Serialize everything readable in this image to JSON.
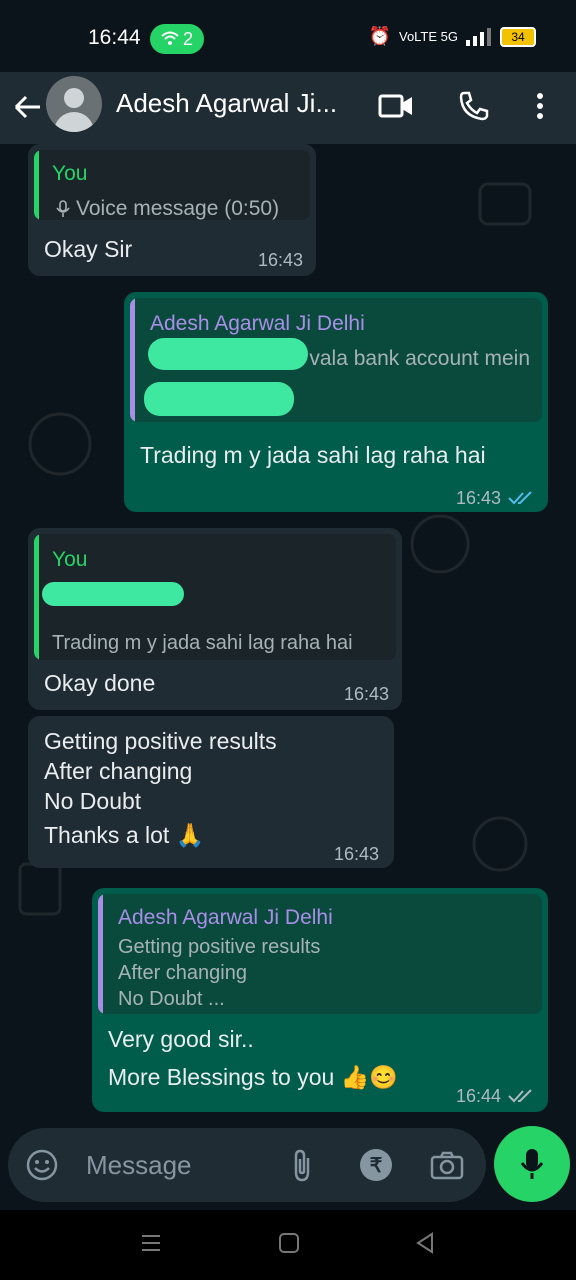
{
  "status": {
    "time": "16:44",
    "hotspot_count": "2",
    "network": "VoLTE 5G",
    "battery": "34"
  },
  "header": {
    "contact_name": "Adesh Agarwal Ji..."
  },
  "messages": {
    "m1": {
      "quote_name": "You",
      "quote_text": "Voice message (0:50)",
      "text": "Okay Sir",
      "time": "16:43"
    },
    "m2": {
      "quote_name": "Adesh Agarwal Ji Delhi",
      "quote_text": "vala bank account mein",
      "text": "Trading m y jada sahi lag raha hai",
      "time": "16:43"
    },
    "m3": {
      "quote_name": "You",
      "quote_text": "Trading m y jada sahi lag raha hai",
      "text": "Okay done",
      "time": "16:43"
    },
    "m4": {
      "line1": "Getting positive results",
      "line2": "After changing",
      "line3": "No Doubt",
      "line4": "Thanks a lot 🙏",
      "time": "16:43"
    },
    "m5": {
      "quote_name": "Adesh Agarwal Ji Delhi",
      "quote_line1": "Getting positive results",
      "quote_line2": "After changing",
      "quote_line3": "No Doubt ...",
      "line1": "Very good sir..",
      "line2": "More Blessings to you 👍😊",
      "time": "16:44"
    }
  },
  "input": {
    "placeholder": "Message"
  },
  "colors": {
    "accent": "#25d366",
    "outgoing": "#005c4b",
    "incoming": "#202c33",
    "quote_you": "#25d366",
    "quote_contact": "#a98ee8",
    "read_ticks": "#53bdeb"
  }
}
